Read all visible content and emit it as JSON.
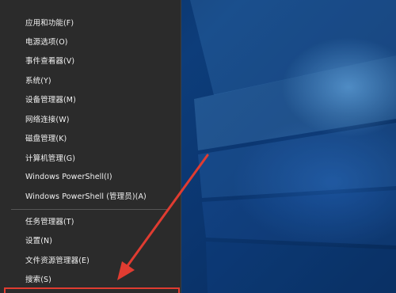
{
  "menu": {
    "items": [
      {
        "label": "应用和功能(F)"
      },
      {
        "label": "电源选项(O)"
      },
      {
        "label": "事件查看器(V)"
      },
      {
        "label": "系统(Y)"
      },
      {
        "label": "设备管理器(M)"
      },
      {
        "label": "网络连接(W)"
      },
      {
        "label": "磁盘管理(K)"
      },
      {
        "label": "计算机管理(G)"
      },
      {
        "label": "Windows PowerShell(I)"
      },
      {
        "label": "Windows PowerShell (管理员)(A)"
      },
      {
        "label": "任务管理器(T)"
      },
      {
        "label": "设置(N)"
      },
      {
        "label": "文件资源管理器(E)"
      },
      {
        "label": "搜索(S)"
      }
    ]
  },
  "annotation": {
    "color": "#e03c31"
  }
}
